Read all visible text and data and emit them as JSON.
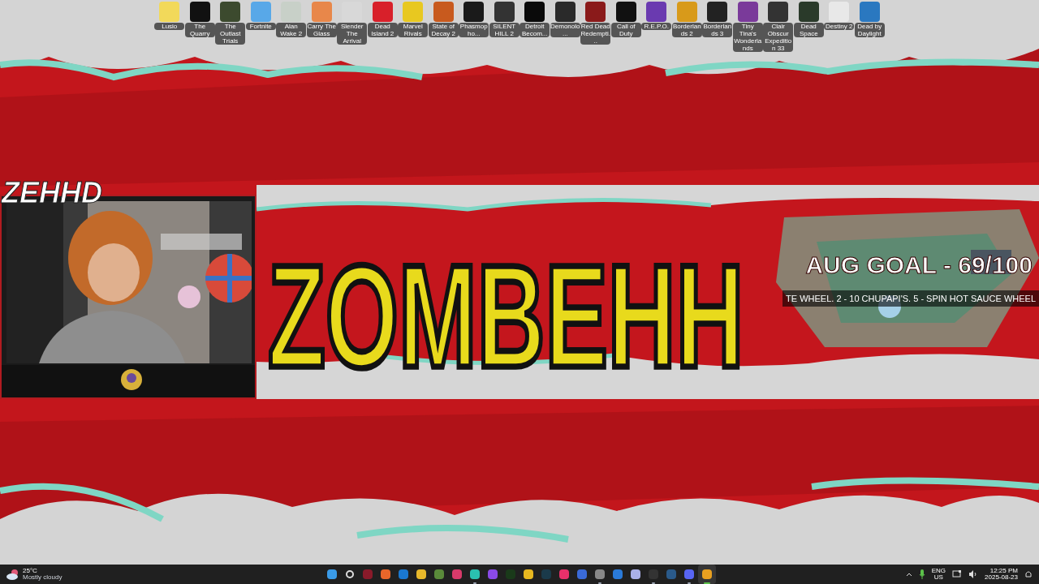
{
  "desktop_icons": [
    {
      "label": "Lusio"
    },
    {
      "label": "The Quarry"
    },
    {
      "label": "The Outlast Trials"
    },
    {
      "label": "Fortnite"
    },
    {
      "label": "Alan Wake 2"
    },
    {
      "label": "Carry The Glass"
    },
    {
      "label": "Slender The Arrival"
    },
    {
      "label": "Dead Island 2"
    },
    {
      "label": "Marvel Rivals"
    },
    {
      "label": "State of Decay 2"
    },
    {
      "label": "Phasmopho..."
    },
    {
      "label": "SILENT HILL 2"
    },
    {
      "label": "Detroit Becom..."
    },
    {
      "label": "Demonolo..."
    },
    {
      "label": "Red Dead Redempti..."
    },
    {
      "label": "Call of Duty"
    },
    {
      "label": "R.E.P.O."
    },
    {
      "label": "Borderlands 2"
    },
    {
      "label": "Borderlands 3"
    },
    {
      "label": "Tiny Tina's Wonderlands"
    },
    {
      "label": "Clair Obscur Expedition 33"
    },
    {
      "label": "Dead Space"
    },
    {
      "label": "Destiny 2"
    },
    {
      "label": "Dead by Daylight"
    }
  ],
  "stream_overlay": {
    "logo": "ZEHHD",
    "title": "ZOMBEHH",
    "goal": "AUG GOAL - 69/100",
    "ticker": "TE WHEEL. 2 - 10 CHUPAPI'S. 5 - SPIN HOT SAUCE WHEEL"
  },
  "taskbar": {
    "weather": {
      "temperature": "25°C",
      "condition": "Mostly cloudy"
    },
    "apps": [
      {
        "running": false,
        "selected": false
      },
      {
        "running": false,
        "selected": false
      },
      {
        "running": false,
        "selected": false
      },
      {
        "running": false,
        "selected": false
      },
      {
        "running": false,
        "selected": false
      },
      {
        "running": false,
        "selected": false
      },
      {
        "running": false,
        "selected": false
      },
      {
        "running": false,
        "selected": false
      },
      {
        "running": true,
        "selected": false
      },
      {
        "running": false,
        "selected": false
      },
      {
        "running": false,
        "selected": false
      },
      {
        "running": false,
        "selected": false
      },
      {
        "running": false,
        "selected": false
      },
      {
        "running": false,
        "selected": false
      },
      {
        "running": false,
        "selected": false
      },
      {
        "running": true,
        "selected": false
      },
      {
        "running": false,
        "selected": false
      },
      {
        "running": false,
        "selected": false
      },
      {
        "running": true,
        "selected": false
      },
      {
        "running": false,
        "selected": false
      },
      {
        "running": true,
        "selected": false
      },
      {
        "running": true,
        "selected": true
      }
    ],
    "tray": {
      "language": "ENG",
      "region": "US",
      "time": "12:25 PM",
      "date": "2025-08-23"
    }
  }
}
